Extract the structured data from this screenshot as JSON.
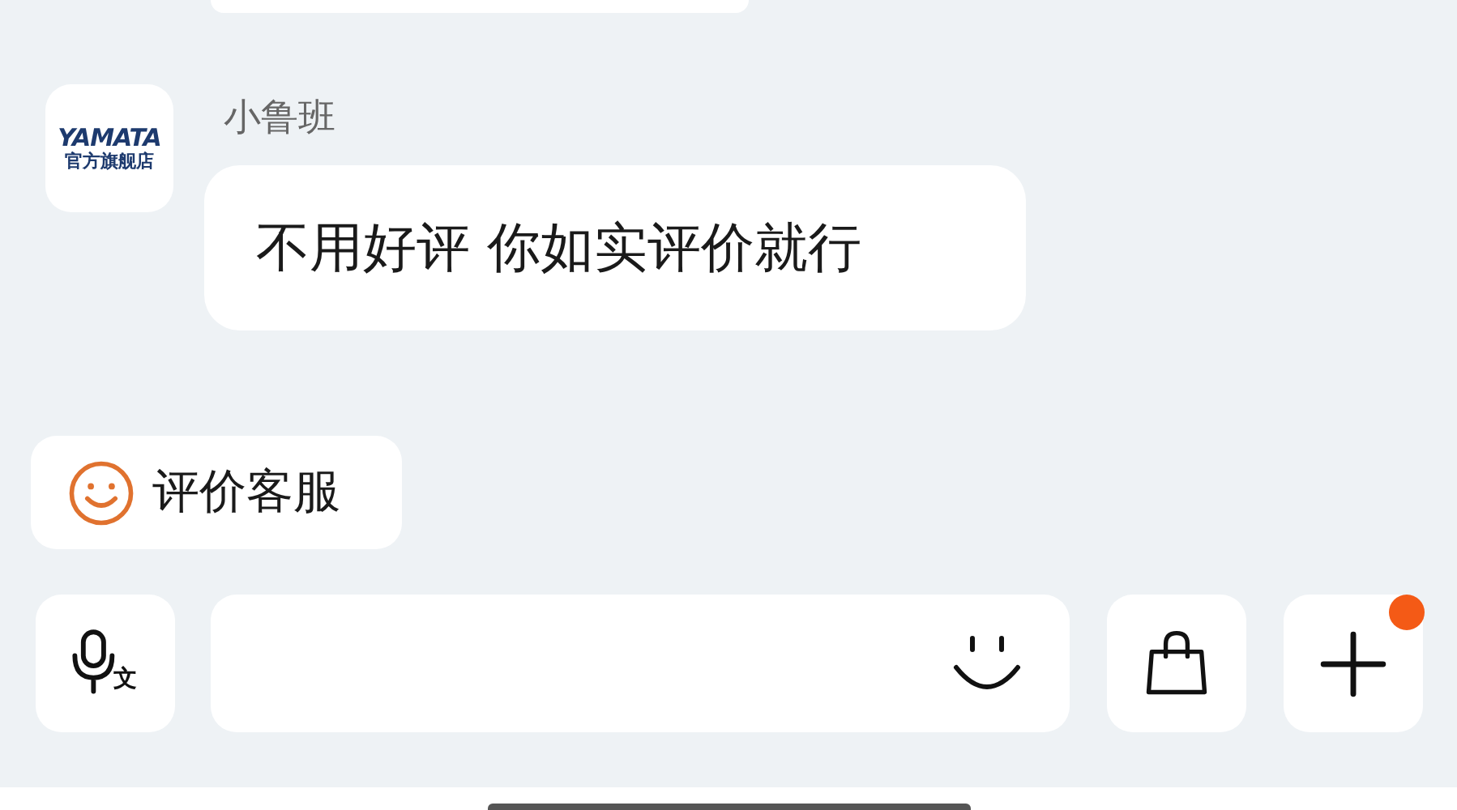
{
  "messages": [
    {
      "sender": "小鲁班",
      "avatar": {
        "brand": "YAMATA",
        "subtitle": "官方旗舰店"
      },
      "text": "不用好评 你如实评价就行"
    }
  ],
  "quick_reply": {
    "label": "评价客服"
  },
  "input_bar": {
    "voice_glyph": "文",
    "plus_badge": true
  }
}
